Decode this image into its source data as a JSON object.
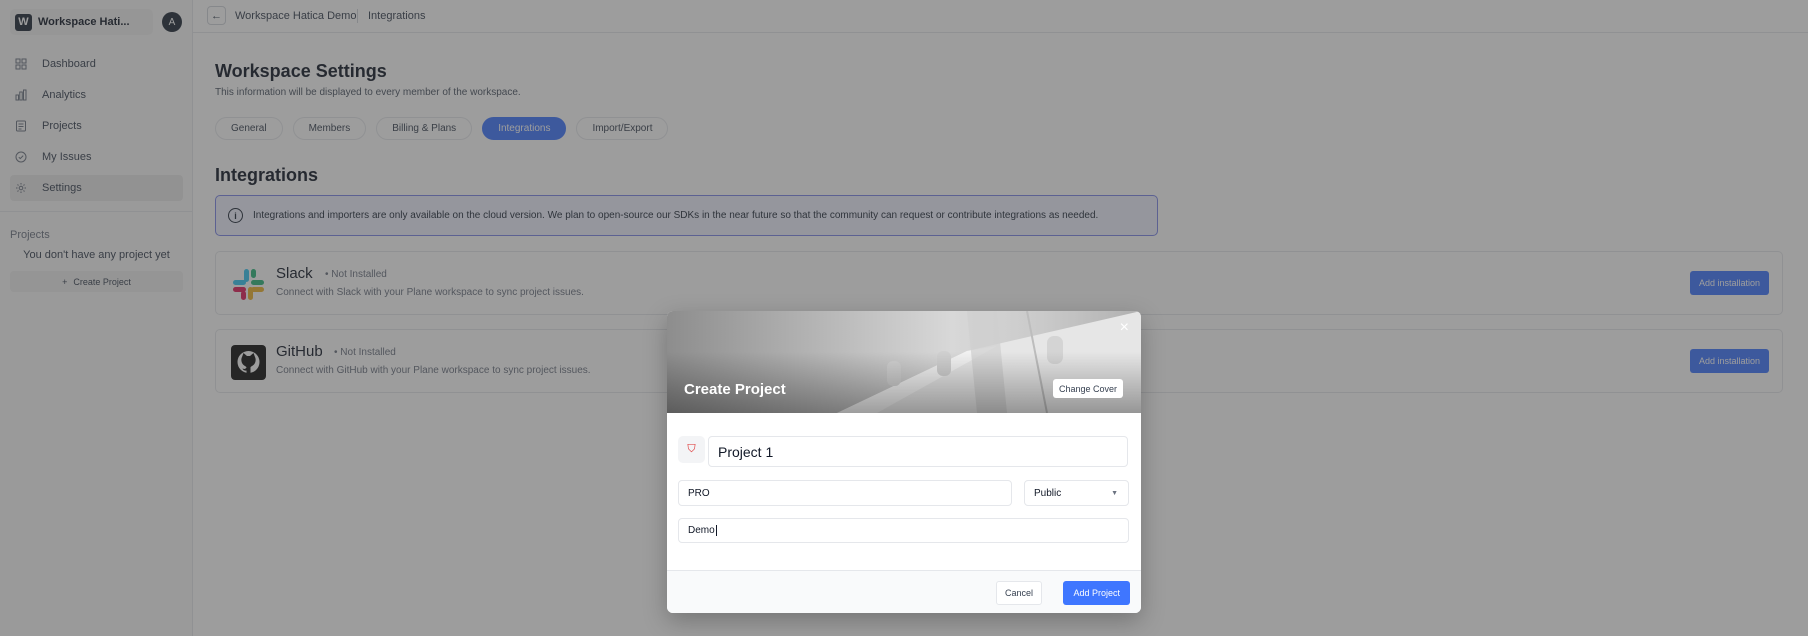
{
  "workspace": {
    "logo_letter": "W",
    "name": "Workspace Hati...",
    "avatar_letter": "A"
  },
  "sidebar": {
    "items": [
      {
        "label": "Dashboard",
        "icon": "grid-icon"
      },
      {
        "label": "Analytics",
        "icon": "bar-chart-icon"
      },
      {
        "label": "Projects",
        "icon": "clipboard-icon"
      },
      {
        "label": "My Issues",
        "icon": "check-circle-icon"
      },
      {
        "label": "Settings",
        "icon": "gear-icon",
        "active": true
      }
    ],
    "projects_label": "Projects",
    "empty_text": "You don't have any project yet",
    "create_project": "Create Project"
  },
  "breadcrumb": {
    "back": "←",
    "items": [
      "Workspace Hatica Demo",
      "Integrations"
    ]
  },
  "header": {
    "title": "Workspace Settings",
    "subtitle": "This information will be displayed to every member of the workspace."
  },
  "tabs": [
    {
      "label": "General"
    },
    {
      "label": "Members"
    },
    {
      "label": "Billing & Plans"
    },
    {
      "label": "Integrations",
      "active": true
    },
    {
      "label": "Import/Export"
    }
  ],
  "integrations": {
    "title": "Integrations",
    "notice": "Integrations and importers are only available on the cloud version. We plan to open-source our SDKs in the near future so that the community can request or contribute integrations as needed.",
    "items": [
      {
        "name": "Slack",
        "status": "• Not Installed",
        "description": "Connect with Slack with your Plane workspace to sync project issues.",
        "button": "Add installation"
      },
      {
        "name": "GitHub",
        "status": "• Not Installed",
        "description": "Connect with GitHub with your Plane workspace to sync project issues.",
        "button": "Add installation"
      }
    ]
  },
  "modal": {
    "title": "Create Project",
    "change_cover": "Change Cover",
    "close": "×",
    "project_name": "Project 1",
    "identifier": "PRO",
    "network": "Public",
    "description": "Demo",
    "cancel": "Cancel",
    "submit": "Add Project"
  },
  "colors": {
    "accent": "#3f76ff",
    "overlay": "rgba(60,60,60,0.5)"
  }
}
